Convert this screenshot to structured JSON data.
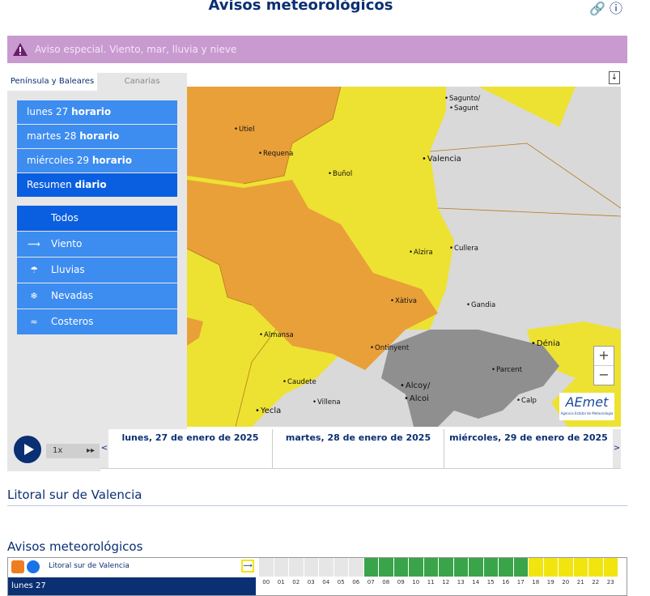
{
  "header": {
    "title": "Avisos meteorológicos"
  },
  "banner": {
    "text": "Aviso especial. Viento, mar, lluvia y nieve"
  },
  "tabs": [
    {
      "label": "Península y Baleares",
      "active": true
    },
    {
      "label": "Canarias",
      "active": false
    }
  ],
  "days": [
    {
      "label": "lunes 27 ",
      "bold": "horario"
    },
    {
      "label": "martes 28 ",
      "bold": "horario"
    },
    {
      "label": "miércoles 29 ",
      "bold": "horario"
    },
    {
      "label": "Resumen ",
      "bold": "diario",
      "selected": true
    }
  ],
  "filters": [
    {
      "label": "Todos",
      "icon": "",
      "selected": true
    },
    {
      "label": "Viento",
      "icon": "wind-icon"
    },
    {
      "label": "Lluvias",
      "icon": "rain-icon"
    },
    {
      "label": "Nevadas",
      "icon": "snow-icon"
    },
    {
      "label": "Costeros",
      "icon": "wave-icon"
    }
  ],
  "map": {
    "cities": [
      "Sagunto/",
      "Sagunt",
      "Utiel",
      "Requena",
      "Valencia",
      "Buñol",
      "Alzira",
      "Cullera",
      "Xàtiva",
      "Gandia",
      "Almansa",
      "Ontinyent",
      "Dénia",
      "Parcent",
      "Caudete",
      "Villena",
      "Alcoy/",
      "Alcoi",
      "Yecla",
      "Calp"
    ],
    "colors": {
      "orange": "#e9a038",
      "yellow": "#ede232",
      "grey": "#d9d9d9",
      "relief": "#8f8f8f"
    },
    "zoom_in": "+",
    "zoom_out": "−",
    "logo": "AEmet",
    "logo_sub": "Agencia Estatal de Meteorología"
  },
  "player": {
    "speed": "1x",
    "ff": "▸▸"
  },
  "timeline": {
    "prev": "<",
    "next": ">",
    "days": [
      "lunes, 27 de enero de 2025",
      "martes, 28 de enero de 2025",
      "miércoles, 29 de enero de 2025"
    ]
  },
  "zone": {
    "title": "Litoral sur de Valencia"
  },
  "section": {
    "title": "Avisos meteorológicos"
  },
  "table": {
    "zone_link": "Litoral sur de Valencia",
    "day_label": "lunes 27",
    "hours": [
      "00",
      "01",
      "02",
      "03",
      "04",
      "05",
      "06",
      "07",
      "08",
      "09",
      "10",
      "11",
      "12",
      "13",
      "14",
      "15",
      "16",
      "17",
      "18",
      "19",
      "20",
      "21",
      "22",
      "23"
    ],
    "levels": [
      "none",
      "none",
      "none",
      "none",
      "none",
      "none",
      "none",
      "green",
      "green",
      "green",
      "green",
      "green",
      "green",
      "green",
      "green",
      "green",
      "green",
      "green",
      "yellow",
      "yellow",
      "yellow",
      "yellow",
      "yellow",
      "yellow"
    ],
    "level_colors": {
      "none": "#e6e6e6",
      "green": "#3aa44a",
      "yellow": "#f2e50f"
    }
  }
}
